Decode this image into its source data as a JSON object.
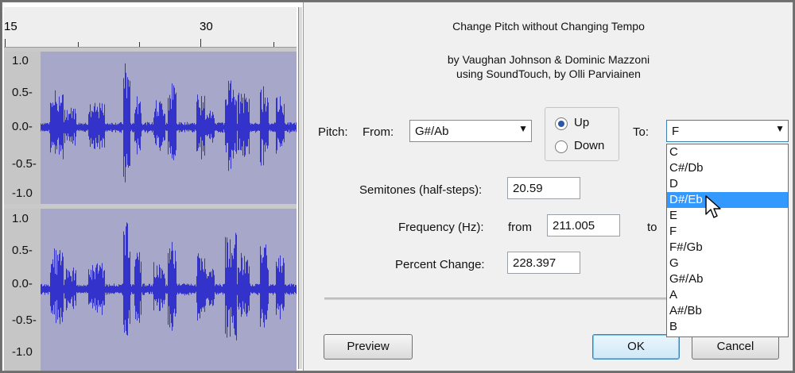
{
  "ruler": {
    "labels": [
      "15",
      "30"
    ]
  },
  "tracks": [
    {
      "labels": [
        "1.0",
        "0.5-",
        "0.0-",
        "-0.5-",
        "-1.0"
      ]
    },
    {
      "labels": [
        "1.0",
        "0.5-",
        "0.0-",
        "-0.5-",
        "-1.0"
      ]
    }
  ],
  "dialog": {
    "title": "Change Pitch without Changing Tempo",
    "credit_line1": "by Vaughan Johnson & Dominic Mazzoni",
    "credit_line2": "using SoundTouch, by Olli Parviainen",
    "pitch_label": "Pitch:",
    "from_label": "From:",
    "from_value": "G#/Ab",
    "direction": {
      "up_label": "Up",
      "down_label": "Down",
      "selected": "Up"
    },
    "to_label": "To:",
    "to_value": "F",
    "semitones_label": "Semitones (half-steps):",
    "semitones_value": "20.59",
    "frequency_label": "Frequency (Hz):",
    "from_word": "from",
    "frequency_from_value": "211.005",
    "to_word": "to",
    "percent_label": "Percent Change:",
    "percent_value": "228.397",
    "buttons": {
      "preview": "Preview",
      "ok": "OK",
      "cancel": "Cancel"
    },
    "pitch_options": [
      "C",
      "C#/Db",
      "D",
      "D#/Eb",
      "E",
      "F",
      "F#/Gb",
      "G",
      "G#/Ab",
      "A",
      "A#/Bb",
      "B"
    ],
    "highlighted_option": "D#/Eb"
  },
  "colors": {
    "waveform": "#3333cc",
    "wave_background": "#a7a7c9",
    "selection": "#3399ff"
  }
}
